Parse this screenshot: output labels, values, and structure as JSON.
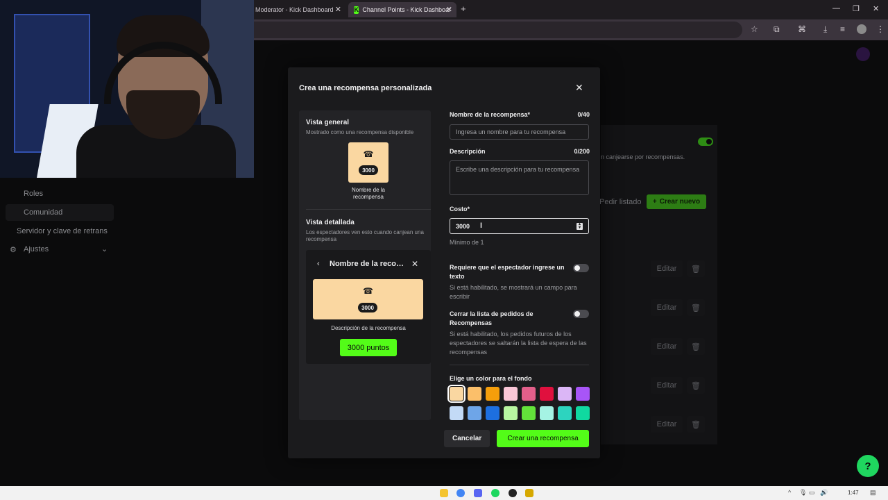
{
  "browser": {
    "tabs": [
      {
        "label": "Moderator - Kick Dashboard",
        "active": false
      },
      {
        "label": "Channel Points - Kick Dashboar",
        "active": true
      }
    ],
    "new_tab_glyph": "+",
    "favicon_letter": "K"
  },
  "sidebar": {
    "items": [
      {
        "label": "Roles"
      },
      {
        "label": "Comunidad",
        "active": true
      },
      {
        "label": "Servidor y clave de retrans"
      },
      {
        "label": "Ajustes"
      }
    ]
  },
  "background_page": {
    "description_fragment": "n canjearse por recompensas.",
    "reorder_label": "Pedir listado",
    "create_new_label": "Crear nuevo",
    "edit_label": "Editar",
    "edit_rows": 5,
    "toggle_on": true
  },
  "modal": {
    "title": "Crea una recompensa personalizada",
    "preview": {
      "overview_heading": "Vista general",
      "overview_sub": "Mostrado como una recompensa disponible",
      "tile_cost": "3000",
      "tile_name": "Nombre de la recompensa",
      "detail_heading": "Vista detallada",
      "detail_sub": "Los espectadores ven esto cuando canjean una recompensa",
      "detail_title": "Nombre de la recompensa",
      "detail_cost": "3000",
      "detail_description": "Descripción de la recompensa",
      "detail_points_button": "3000 puntos",
      "tile_color": "#fad7a1"
    },
    "form": {
      "name_label": "Nombre de la recompensa*",
      "name_count": "0/40",
      "name_placeholder": "Ingresa un nombre para tu recompensa",
      "description_label": "Descripción",
      "description_count": "0/200",
      "description_placeholder": "Escribe una descripción para tu recompensa",
      "cost_label": "Costo*",
      "cost_value": "3000",
      "cost_help": "Mínimo de 1",
      "require_text_label": "Requiere que el espectador ingrese un texto",
      "require_text_help": "Si está habilitado, se mostrará un campo para escribir",
      "require_text_on": false,
      "skip_queue_label": "Cerrar la lista de pedidos de Recompensas",
      "skip_queue_help": "Si está habilitado, los pedidos futuros de los espectadores se saltarán la lista de espera de las recompensas",
      "skip_queue_on": false,
      "color_label": "Elige un color para el fondo",
      "colors": [
        "#fad7a1",
        "#fbbf6a",
        "#f59e0b",
        "#f9c6d6",
        "#e25f8a",
        "#e0103e",
        "#dbb6f6",
        "#a855f7",
        "#c3daf6",
        "#6ea5e8",
        "#1d6fe0",
        "#b8f5a0",
        "#63e23a",
        "#a5f3e4",
        "#2dd4bf",
        "#10d9a0"
      ],
      "selected_color_index": 0,
      "cancel_label": "Cancelar",
      "submit_label": "Crear una recompensa"
    }
  },
  "taskbar": {
    "time": "1:47"
  },
  "colors": {
    "accent": "#53fc18",
    "modal_bg": "#1b1b1d",
    "panel_bg": "#232326"
  }
}
